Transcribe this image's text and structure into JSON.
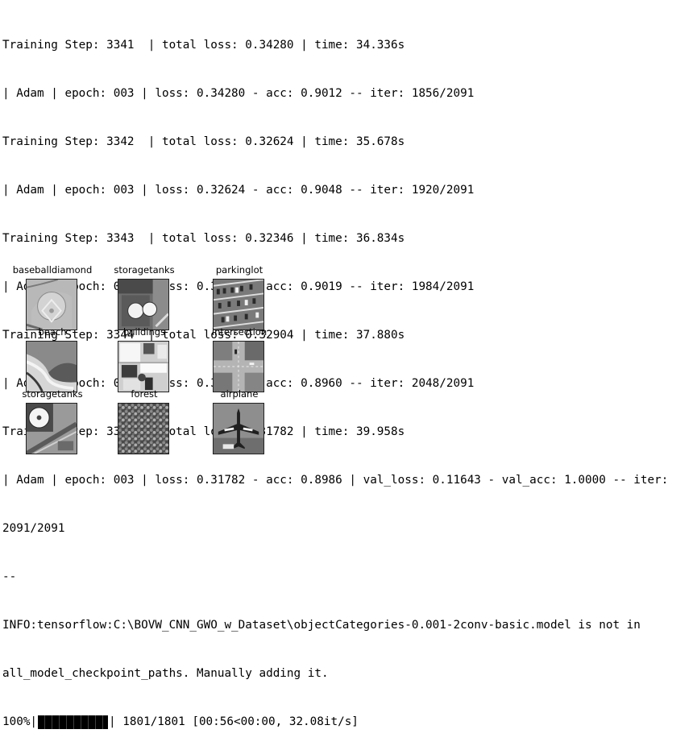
{
  "log_lines": [
    "Training Step: 3341  | total loss: 0.34280 | time: 34.336s",
    "| Adam | epoch: 003 | loss: 0.34280 - acc: 0.9012 -- iter: 1856/2091",
    "Training Step: 3342  | total loss: 0.32624 | time: 35.678s",
    "| Adam | epoch: 003 | loss: 0.32624 - acc: 0.9048 -- iter: 1920/2091",
    "Training Step: 3343  | total loss: 0.32346 | time: 36.834s",
    "| Adam | epoch: 003 | loss: 0.32346 - acc: 0.9019 -- iter: 1984/2091",
    "Training Step: 3344  | total loss: 0.32904 | time: 37.880s",
    "| Adam | epoch: 003 | loss: 0.32904 - acc: 0.8960 -- iter: 2048/2091",
    "Training Step: 3345  | total loss: 0.31782 | time: 39.958s",
    "| Adam | epoch: 003 | loss: 0.31782 - acc: 0.8986 | val_loss: 0.11643 - val_acc: 1.0000 -- iter:",
    "2091/2091",
    "--",
    "INFO:tensorflow:C:\\BOVW_CNN_GWO_w_Dataset\\objectCategories-0.001-2conv-basic.model is not in",
    "all_model_checkpoint_paths. Manually adding it."
  ],
  "progress": {
    "percent_text": "100%|",
    "fraction": 1.0,
    "suffix_text": "| 1801/1801 [00:56<00:00, 32.08it/s]"
  },
  "images": [
    {
      "label": "baseballdiamond",
      "icon": "baseball-diamond-aerial"
    },
    {
      "label": "storagetanks",
      "icon": "storage-tanks-aerial"
    },
    {
      "label": "parkinglot",
      "icon": "parking-lot-aerial"
    },
    {
      "label": "beach",
      "icon": "beach-aerial"
    },
    {
      "label": "buildings",
      "icon": "buildings-aerial"
    },
    {
      "label": "intersection",
      "icon": "intersection-aerial"
    },
    {
      "label": "storagetanks",
      "icon": "storage-tank-aerial"
    },
    {
      "label": "forest",
      "icon": "forest-aerial"
    },
    {
      "label": "airplane",
      "icon": "airplane-aerial"
    }
  ]
}
